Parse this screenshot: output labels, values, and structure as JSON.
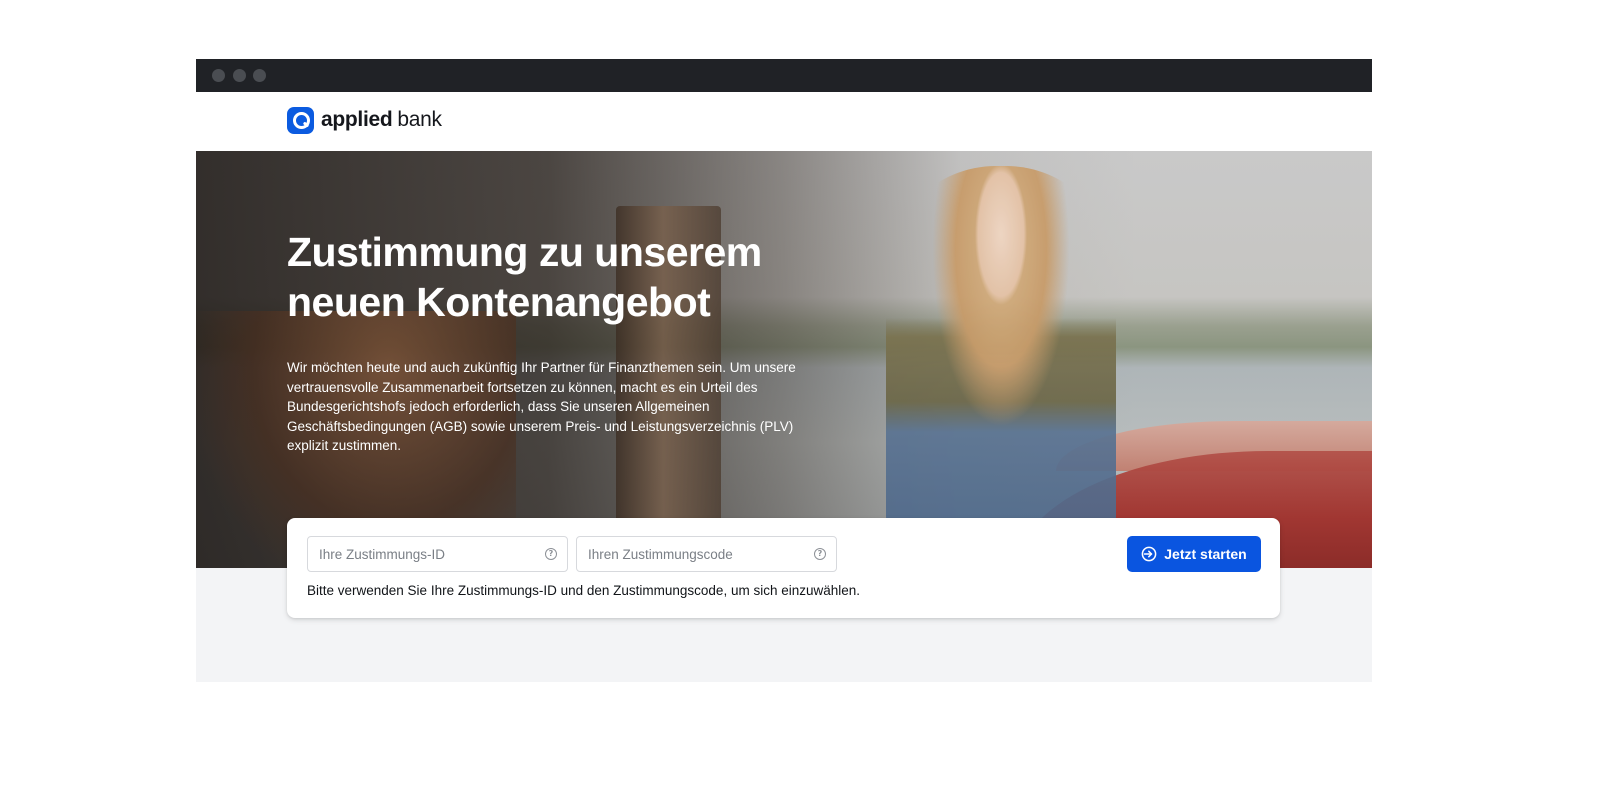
{
  "brand": {
    "name_bold": "applied",
    "name_light": "bank",
    "accent_color": "#0a55e0"
  },
  "hero": {
    "title": "Zustimmung zu unserem neuen Kontenangebot",
    "text": "Wir möchten heute und auch zukünftig Ihr Partner für Finanzthemen sein. Um unsere vertrauensvolle Zusammenarbeit fortsetzen zu können, macht es ein Urteil des Bundesgerichtshofs jedoch erforderlich, dass Sie unseren Allgemeinen Geschäftsbedingungen (AGB) sowie unserem Preis- und Leistungsverzeichnis (PLV) explizit zustimmen."
  },
  "login": {
    "id_placeholder": "Ihre Zustimmungs-ID",
    "id_value": "",
    "code_placeholder": "Ihren Zustimmungscode",
    "code_value": "",
    "help_glyph": "?",
    "start_label": "Jetzt starten",
    "start_icon": "enter-icon",
    "hint": "Bitte verwenden Sie Ihre Zustimmungs-ID und den Zustimmungscode, um sich einzuwählen."
  }
}
